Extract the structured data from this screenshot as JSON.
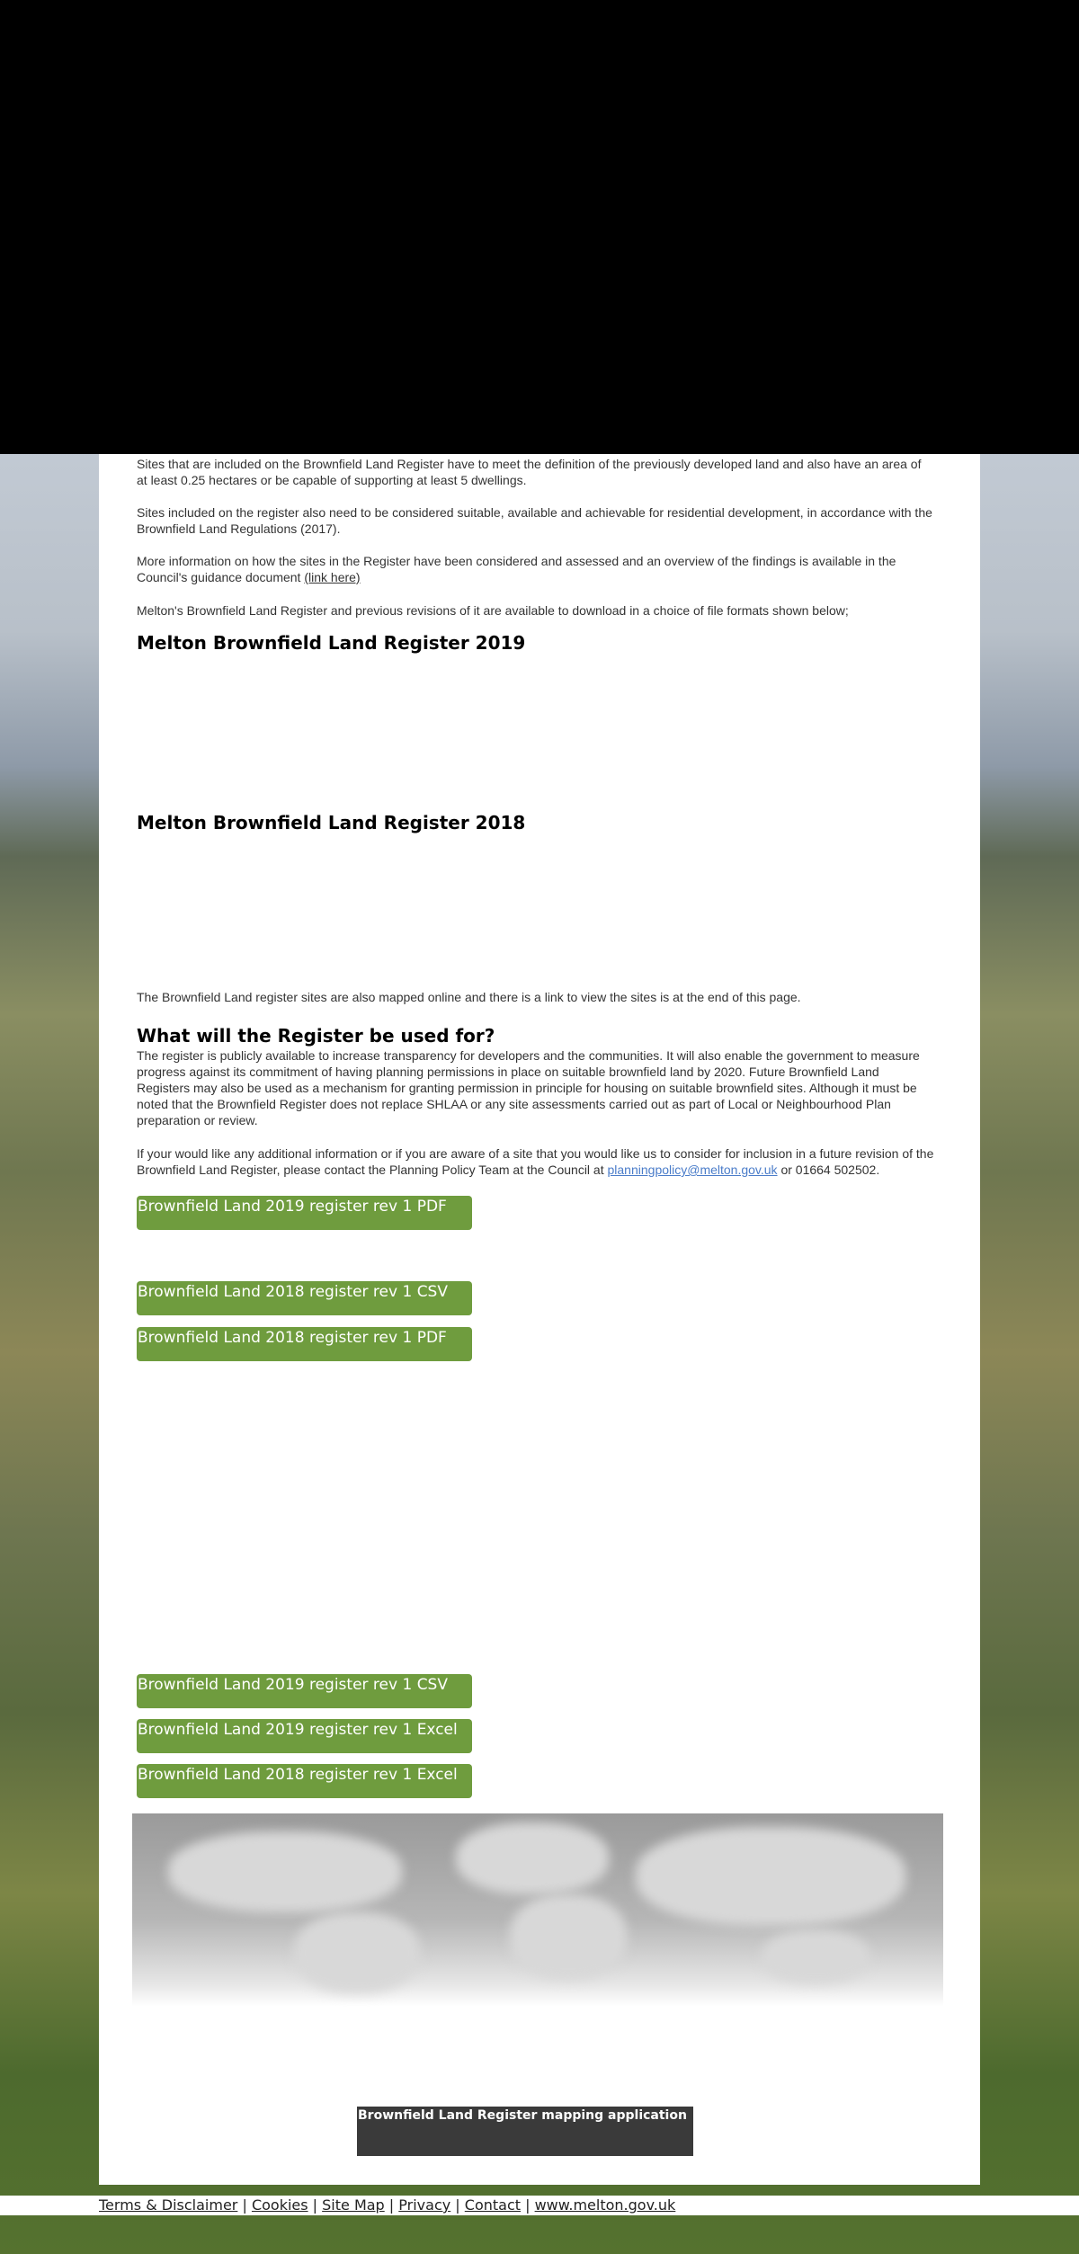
{
  "content": {
    "p1": "Sites that are included on the Brownfield Land Register have to meet the definition of the previously developed land and also have an area of at least 0.25 hectares or be capable of supporting at least 5 dwellings.",
    "p2": "Sites included on the register also need to be considered suitable, available and achievable for residential development, in accordance with the Brownfield Land Regulations (2017).",
    "p3_text": "More information on how the sites in the Register have been considered and assessed and an overview of the findings is available in the Council's guidance document ",
    "p3_link": "(link here)",
    "p4": "Melton's Brownfield Land Register and previous revisions of it are available to download in a choice of  file formats shown below;",
    "heading_2019": "Melton Brownfield Land Register 2019",
    "heading_2018": "Melton Brownfield Land Register 2018",
    "p5": "The Brownfield Land register sites are also mapped online and there is a link to view the sites is at the end of this page.",
    "heading_use": "What will the Register be used for?",
    "p6": "The register is publicly available to increase transparency for developers and the communities. It will also enable the government to measure progress against its commitment of having planning permissions in place on suitable brownfield land by 2020. Future Brownfield Land Registers may also be used as a mechanism for granting permission in principle for housing on suitable brownfield sites. Although it must be noted that the Brownfield Register does not replace SHLAA or any site assessments carried out as part of Local or Neighbourhood Plan preparation or review.",
    "p7_text": "If your would like any additional information or if you are aware of a site that you would like us to consider for inclusion in a future revision of the Brownfield Land Register, please contact the Planning Policy Team at the Council at ",
    "p7_email": "planningpolicy@melton.gov.uk",
    "p7_tail": " or 01664 502502."
  },
  "buttons": {
    "b2019_pdf": "Brownfield Land 2019 register rev 1 PDF",
    "b2018_csv": "Brownfield Land 2018 register rev 1 CSV",
    "b2018_pdf": "Brownfield Land 2018 register rev 1 PDF",
    "b2019_csv": "Brownfield Land 2019 register rev 1 CSV",
    "b2019_excel": "Brownfield Land 2019 register rev 1 Excel",
    "b2018_excel": "Brownfield Land 2018 register rev 1 Excel"
  },
  "map_button": "Brownfield Land Register mapping application",
  "footer": {
    "terms": "Terms & Disclaimer",
    "cookies": "Cookies",
    "sitemap": "Site Map",
    "privacy": "Privacy",
    "contact": "Contact",
    "website": "www.melton.gov.uk",
    "sep": " | "
  },
  "colors": {
    "button_green": "#6f9c3e",
    "map_button_bg": "#3a3a3a",
    "link_blue": "#4a7cc9"
  }
}
